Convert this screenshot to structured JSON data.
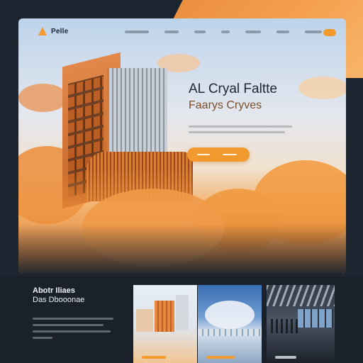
{
  "brand": {
    "logo_text": "Pelle"
  },
  "hero": {
    "title": "AL Cryal Faltte",
    "subtitle": "Faarys Cryves"
  },
  "feature": {
    "title": "Abotr Iliaes",
    "subtitle": "Das Dbooonae"
  },
  "colors": {
    "accent": "#f39a2e",
    "dark_bg": "#1d2530",
    "text_dark": "#1e2735",
    "text_light": "#eef1f5"
  },
  "icons": {
    "logo": "triangle-logo-icon"
  }
}
